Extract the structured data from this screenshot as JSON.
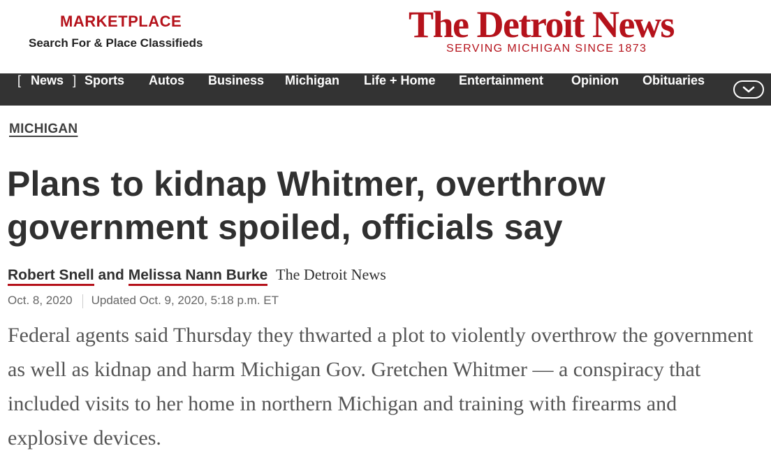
{
  "marketplace": {
    "title": "MARKETPLACE",
    "subtitle": "Search For & Place Classifieds"
  },
  "brand": {
    "name": "The Detroit News",
    "tagline": "SERVING MICHIGAN SINCE 1873",
    "color": "#b5121b"
  },
  "nav": {
    "items": [
      {
        "label": "News",
        "active": true
      },
      {
        "label": "Sports"
      },
      {
        "label": "Autos"
      },
      {
        "label": "Business"
      },
      {
        "label": "Michigan"
      },
      {
        "label": "Life + Home"
      },
      {
        "label": "Entertainment"
      },
      {
        "label": "Opinion"
      },
      {
        "label": "Obituaries"
      }
    ],
    "open_bracket": "[",
    "close_bracket": "]",
    "more_icon": "chevron-down-icon",
    "background": "#333333"
  },
  "article": {
    "section": "MICHIGAN",
    "headline": "Plans to kidnap Whitmer, overthrow government spoiled, officials say",
    "authors": [
      "Robert Snell",
      "Melissa Nann Burke"
    ],
    "author_joiner": "and",
    "publication": "The Detroit News",
    "published": "Oct. 8, 2020",
    "updated": "Updated Oct. 9, 2020, 5:18 p.m. ET",
    "body": "Federal agents said Thursday they thwarted a plot to violently overthrow the government as well as kidnap and harm Michigan Gov. Gretchen Whitmer — a conspiracy that included visits to her home in northern Michigan and training with firearms and explosive devices."
  }
}
